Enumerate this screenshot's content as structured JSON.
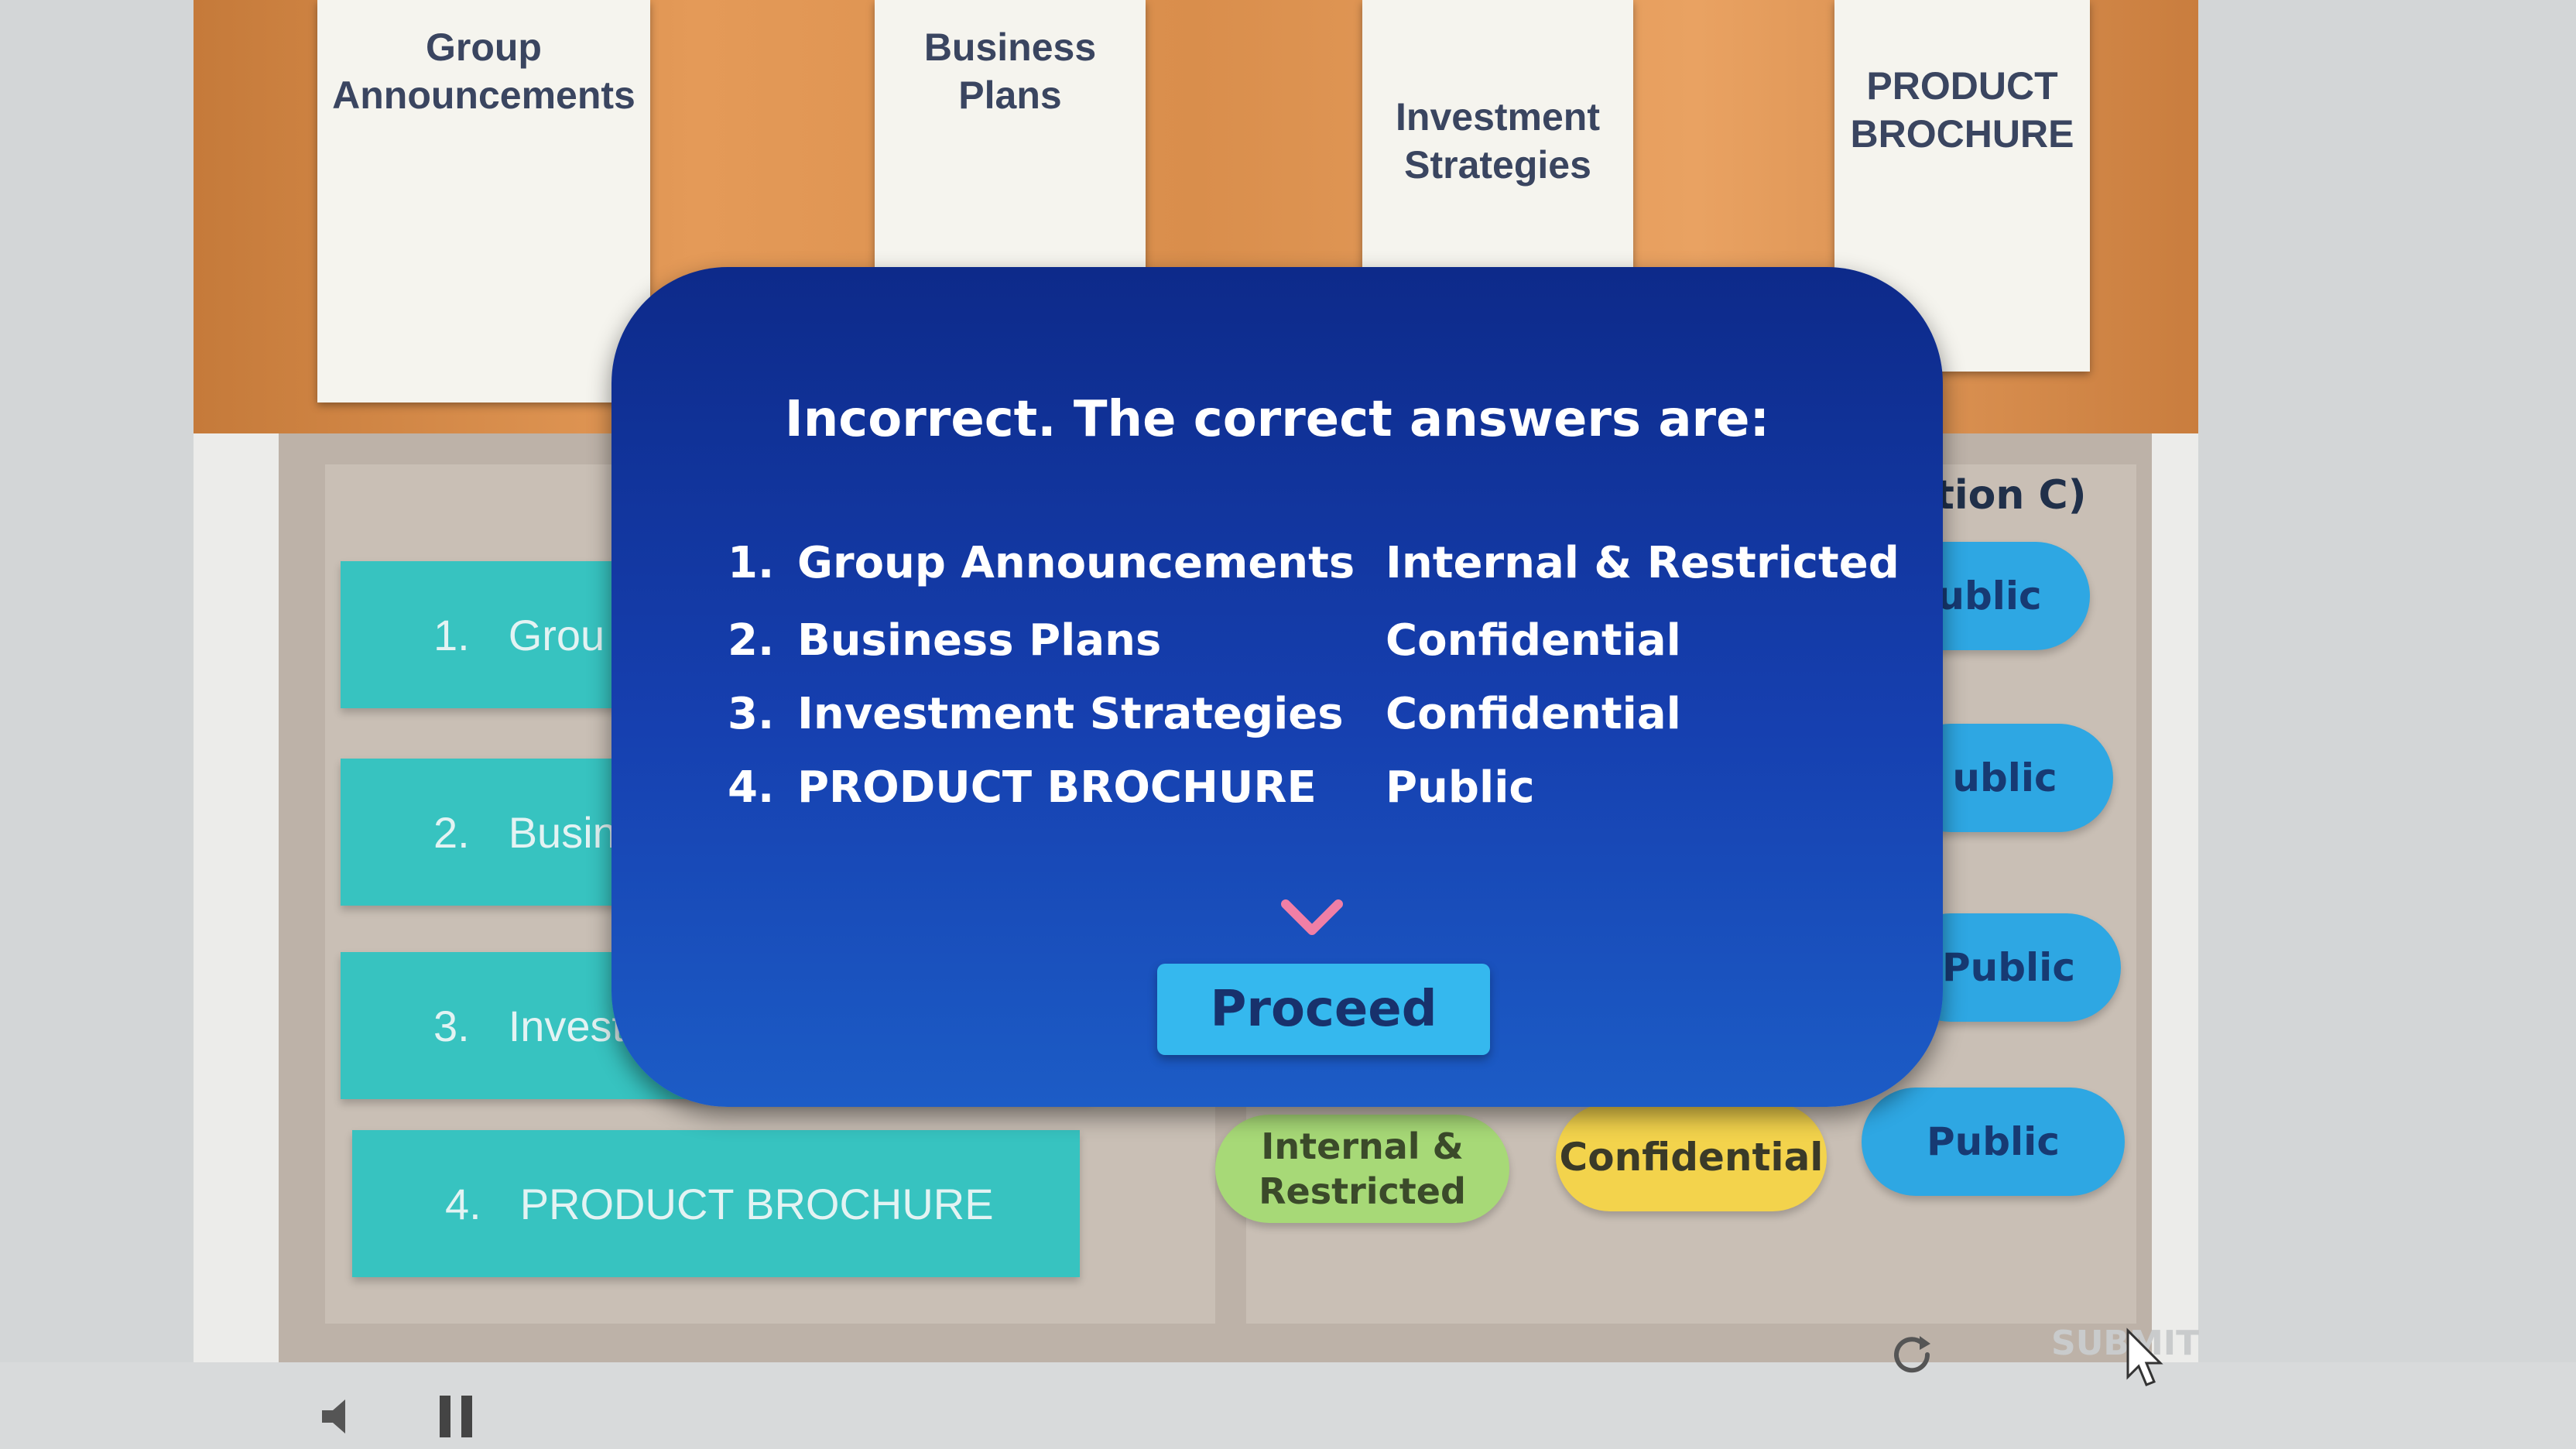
{
  "books": [
    {
      "title": "Group Announcements"
    },
    {
      "title": "Business Plans"
    },
    {
      "title": "Investment Strategies"
    },
    {
      "title": "PRODUCT BROCHURE"
    }
  ],
  "background": {
    "column_header_partial": "tion C)",
    "items": [
      {
        "num": "1.",
        "label": "Grou"
      },
      {
        "num": "2.",
        "label": "Busin"
      },
      {
        "num": "3.",
        "label": "Invest"
      },
      {
        "num": "4.",
        "label": "PRODUCT BROCHURE"
      }
    ],
    "right_pills": [
      "ublic",
      "ublic",
      "Public"
    ],
    "option_pills": [
      "Internal & Restricted",
      "Confidential",
      "Public"
    ]
  },
  "modal": {
    "title": "Incorrect. The correct answers are:",
    "rows": [
      {
        "num": "1.",
        "name": "Group Announcements",
        "answer": "Internal & Restricted"
      },
      {
        "num": "2.",
        "name": "Business Plans",
        "answer": "Confidential"
      },
      {
        "num": "3.",
        "name": "Investment Strategies",
        "answer": "Confidential"
      },
      {
        "num": "4.",
        "name": "PRODUCT BROCHURE",
        "answer": "Public"
      }
    ],
    "proceed_label": "Proceed"
  },
  "controls": {
    "replay_icon": "refresh-icon",
    "pause_icon": "pause-icon",
    "volume_icon": "speaker-icon",
    "submit_label": "SUBMIT"
  },
  "colors": {
    "modal_bg": "#1640b0",
    "proceed_bg": "#35b8ee",
    "item_teal": "#37c3c0",
    "pill_blue": "#2ea7e3",
    "pill_green": "#a7d977",
    "pill_yellow": "#f3d34c",
    "chevron": "#f07fa6"
  }
}
